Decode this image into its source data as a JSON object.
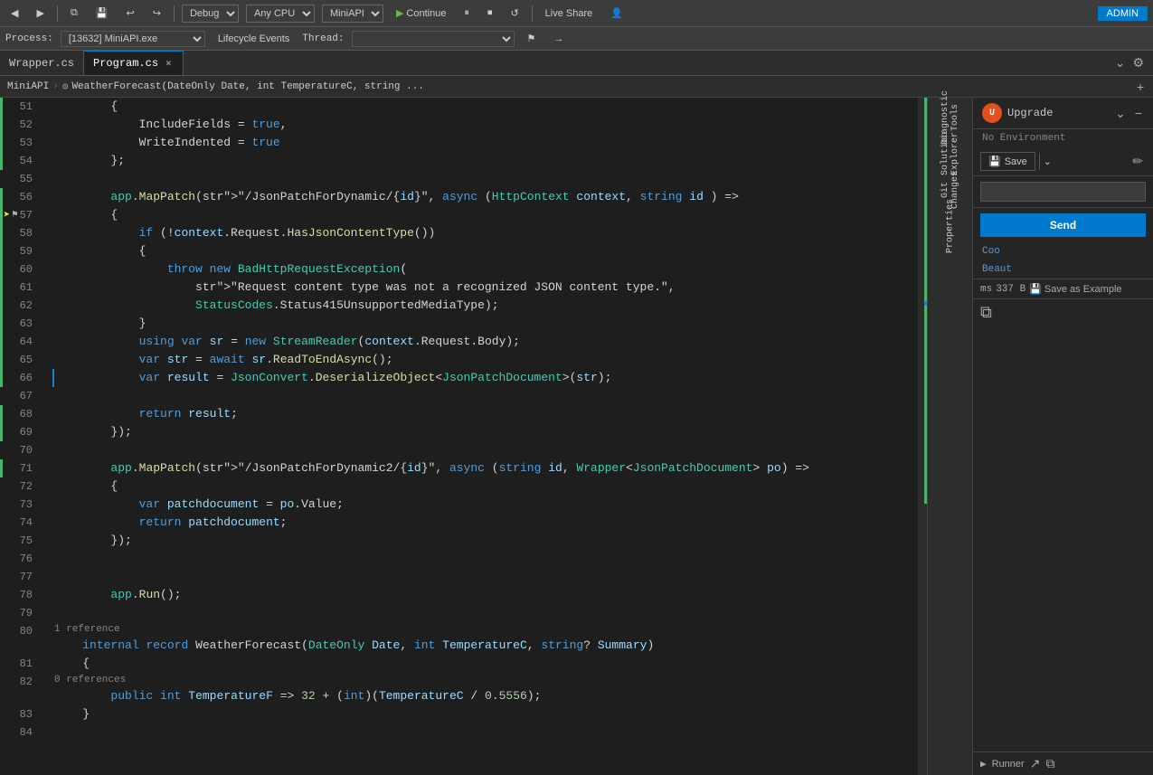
{
  "toolbar": {
    "back_btn": "◀",
    "forward_btn": "▶",
    "debug_label": "Debug",
    "cpu_label": "Any CPU",
    "api_label": "MiniAPI",
    "continue_label": "Continue",
    "live_share_label": "Live Share",
    "admin_label": "ADMIN"
  },
  "process_bar": {
    "process_label": "Process:",
    "process_value": "[13632] MiniAPI.exe",
    "lifecycle_label": "Lifecycle Events",
    "thread_label": "Thread:"
  },
  "tabs": [
    {
      "id": "wrapper",
      "label": "Wrapper.cs",
      "active": false,
      "modified": false
    },
    {
      "id": "program",
      "label": "Program.cs",
      "active": true,
      "modified": true
    }
  ],
  "breadcrumb": {
    "project": "MiniAPI",
    "method": "WeatherForecast(DateOnly Date, int TemperatureC, string ..."
  },
  "code": {
    "lines": [
      {
        "num": 51,
        "ind": "green",
        "content": "        {"
      },
      {
        "num": 52,
        "ind": "green",
        "content": "            IncludeFields = true,"
      },
      {
        "num": 53,
        "ind": "green",
        "content": "            WriteIndented = true"
      },
      {
        "num": 54,
        "ind": "green",
        "content": "        };"
      },
      {
        "num": 55,
        "ind": "",
        "content": ""
      },
      {
        "num": 56,
        "ind": "green",
        "content": "        app.MapPatch(\"/JsonPatchForDynamic/{id}\", async (HttpContext context, string id ) =>"
      },
      {
        "num": 57,
        "ind": "green",
        "content": "        {",
        "breakpoint": true,
        "arrow": true,
        "bookmark": true
      },
      {
        "num": 58,
        "ind": "green",
        "content": "            if (!context.Request.HasJsonContentType())"
      },
      {
        "num": 59,
        "ind": "green",
        "content": "            {"
      },
      {
        "num": 60,
        "ind": "green",
        "content": "                throw new BadHttpRequestException("
      },
      {
        "num": 61,
        "ind": "green",
        "content": "                    \"Request content type was not a recognized JSON content type.\","
      },
      {
        "num": 62,
        "ind": "green",
        "content": "                    StatusCodes.Status415UnsupportedMediaType);"
      },
      {
        "num": 63,
        "ind": "green",
        "content": "            }"
      },
      {
        "num": 64,
        "ind": "green",
        "content": "            using var sr = new StreamReader(context.Request.Body);"
      },
      {
        "num": 65,
        "ind": "green",
        "content": "            var str = await sr.ReadToEndAsync();"
      },
      {
        "num": 66,
        "ind": "green",
        "content": "            var result = JsonConvert.DeserializeObject<JsonPatchDocument>(str);",
        "blue": true
      },
      {
        "num": 67,
        "ind": "",
        "content": ""
      },
      {
        "num": 68,
        "ind": "green",
        "content": "            return result;"
      },
      {
        "num": 69,
        "ind": "green",
        "content": "        });"
      },
      {
        "num": 70,
        "ind": "",
        "content": ""
      },
      {
        "num": 71,
        "ind": "green",
        "content": "        app.MapPatch(\"/JsonPatchForDynamic2/{id}\", async (string id, Wrapper<JsonPatchDocument> po) =>"
      },
      {
        "num": 72,
        "ind": "",
        "content": "        {"
      },
      {
        "num": 73,
        "ind": "",
        "content": "            var patchdocument = po.Value;"
      },
      {
        "num": 74,
        "ind": "",
        "content": "            return patchdocument;"
      },
      {
        "num": 75,
        "ind": "",
        "content": "        });"
      },
      {
        "num": 76,
        "ind": "",
        "content": ""
      },
      {
        "num": 77,
        "ind": "",
        "content": ""
      },
      {
        "num": 78,
        "ind": "",
        "content": "        app.Run();"
      },
      {
        "num": 79,
        "ind": "",
        "content": ""
      },
      {
        "num": 80,
        "ind": "",
        "content": "    internal record WeatherForecast(DateOnly Date, int TemperatureC, string? Summary)",
        "ref": "1 reference"
      },
      {
        "num": 81,
        "ind": "",
        "content": "    {"
      },
      {
        "num": 82,
        "ind": "",
        "content": "        public int TemperatureF => 32 + (int)(TemperatureC / 0.5556);",
        "ref": "0 references"
      },
      {
        "num": 83,
        "ind": "",
        "content": "    }"
      },
      {
        "num": 84,
        "ind": "",
        "content": ""
      }
    ]
  },
  "sidebar": {
    "items": [
      {
        "id": "diagnostic",
        "label": "Diagnostic Tools"
      },
      {
        "id": "solution",
        "label": "Solution Explorer"
      },
      {
        "id": "git",
        "label": "Git Changes"
      },
      {
        "id": "properties",
        "label": "Properties"
      }
    ]
  },
  "api_panel": {
    "logo_text": "U",
    "title": "Upgrade",
    "no_env": "No Environment",
    "save_label": "Save",
    "send_label": "Send",
    "search_placeholder": "",
    "cool_label": "Coo",
    "beautify_label": "Beaut",
    "status_ms": "ms",
    "status_size": "337 B",
    "save_example_label": "Save as Example",
    "runner_label": "Runner"
  }
}
